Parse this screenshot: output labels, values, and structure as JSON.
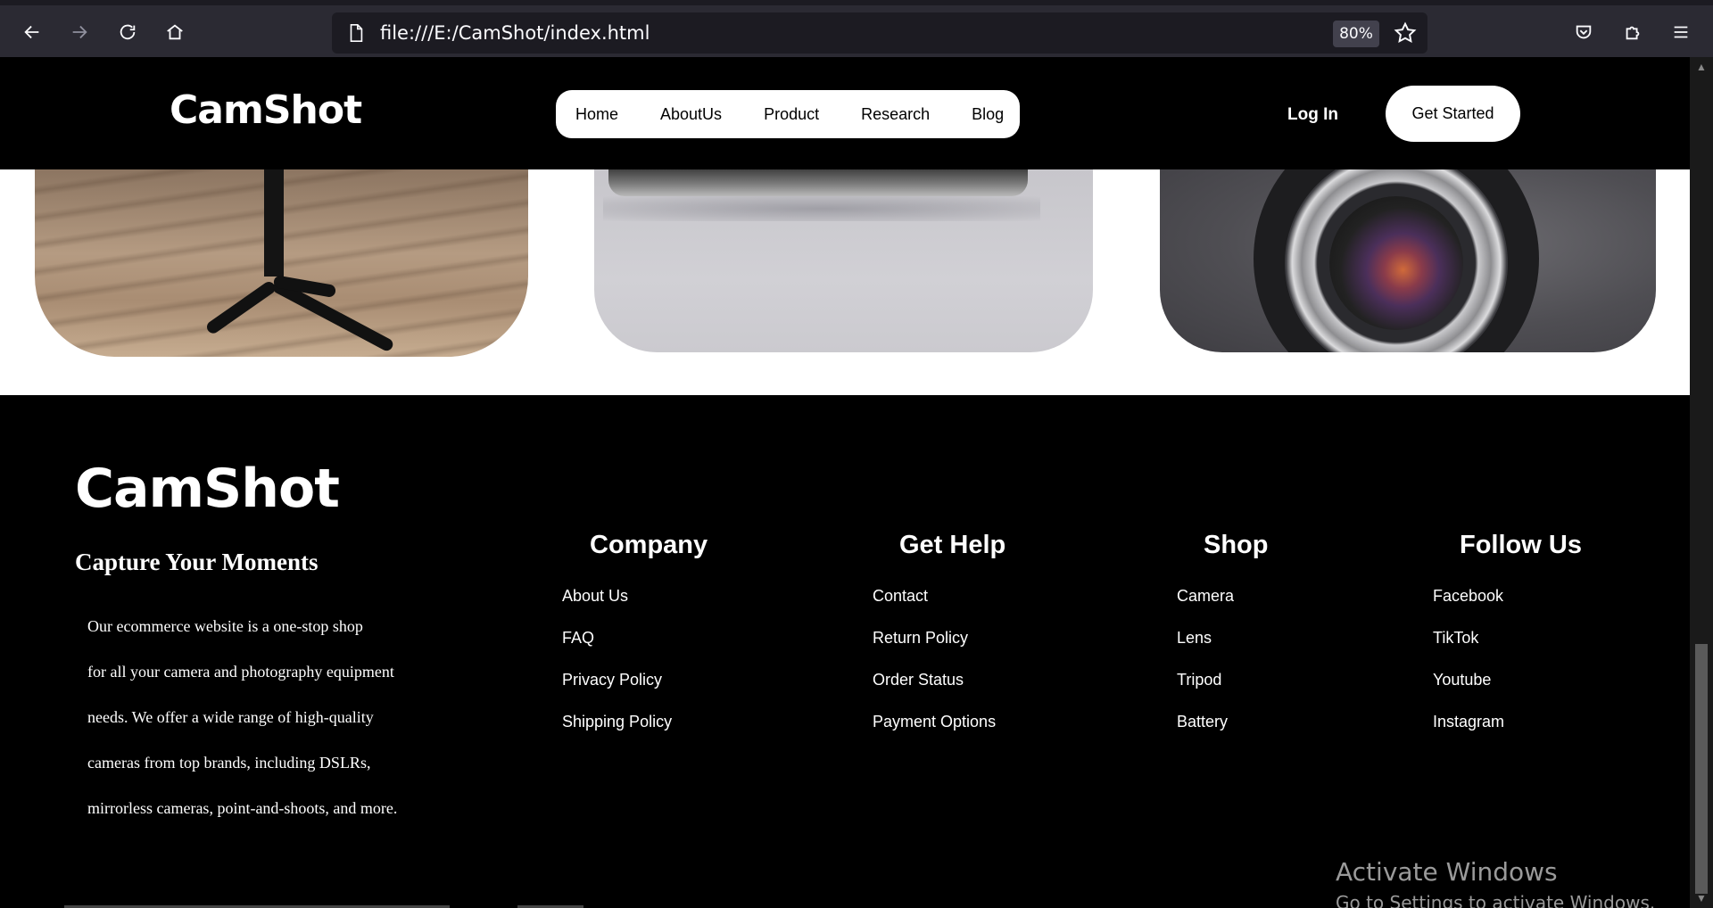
{
  "browser": {
    "url": "file:///E:/CamShot/index.html",
    "zoom": "80%",
    "icons": [
      "back-icon",
      "forward-icon",
      "reload-icon",
      "home-icon",
      "page-icon",
      "bookmark-star-icon",
      "pocket-icon",
      "extensions-icon",
      "menu-icon"
    ]
  },
  "header": {
    "brand": "CamShot",
    "nav": [
      "Home",
      "AboutUs",
      "Product",
      "Research",
      "Blog"
    ],
    "login": "Log In",
    "cta": "Get Started"
  },
  "footer": {
    "brand": "CamShot",
    "tagline": "Capture Your Moments",
    "about_lines": [
      "Our ecommerce website is a one-stop shop",
      "for all your camera and photography equipment",
      "needs. We offer a wide range of high-quality",
      "cameras from top brands, including DSLRs,",
      "mirrorless cameras, point-and-shoots, and more."
    ],
    "columns": [
      {
        "title": "Company",
        "links": [
          "About Us",
          "FAQ",
          "Privacy Policy",
          "Shipping Policy"
        ]
      },
      {
        "title": "Get Help",
        "links": [
          "Contact",
          "Return Policy",
          "Order Status",
          "Payment Options"
        ]
      },
      {
        "title": "Shop",
        "links": [
          "Camera",
          "Lens",
          "Tripod",
          "Battery"
        ]
      },
      {
        "title": "Follow Us",
        "links": [
          "Facebook",
          "TikTok",
          "Youtube",
          "Instagram"
        ]
      }
    ]
  },
  "watermark": {
    "line1": "Activate Windows",
    "line2": "Go to Settings to activate Windows."
  }
}
